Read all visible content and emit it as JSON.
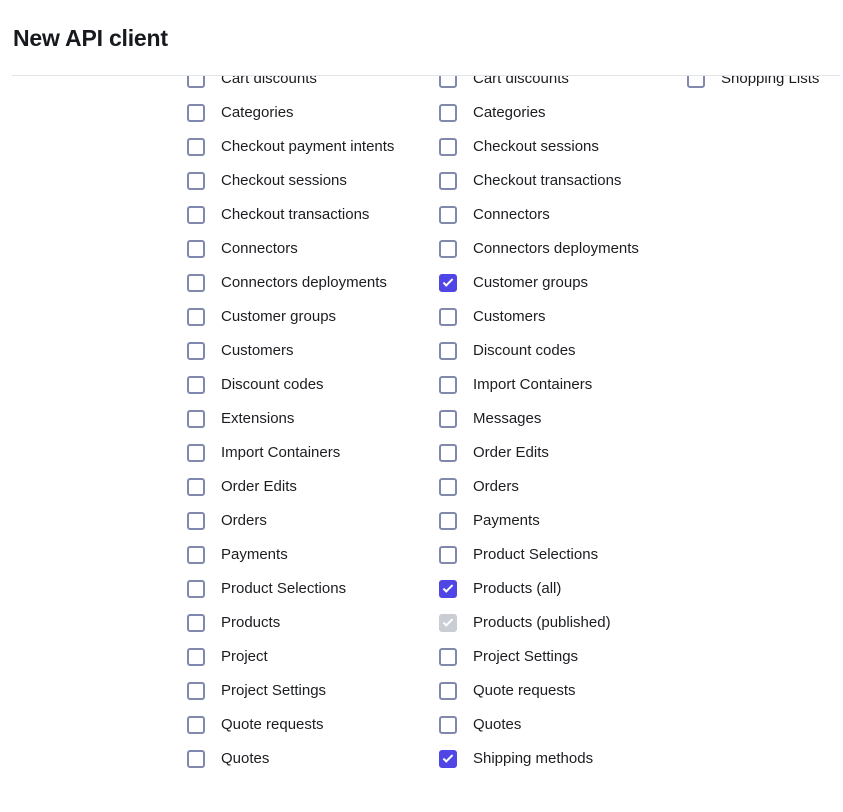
{
  "header": {
    "title": "New API client"
  },
  "scopes": {
    "columns": [
      {
        "name": "permissions-left",
        "items": [
          {
            "label": "Cart discounts",
            "checked": false,
            "disabled": false
          },
          {
            "label": "Categories",
            "checked": false,
            "disabled": false
          },
          {
            "label": "Checkout payment intents",
            "checked": false,
            "disabled": false
          },
          {
            "label": "Checkout sessions",
            "checked": false,
            "disabled": false
          },
          {
            "label": "Checkout transactions",
            "checked": false,
            "disabled": false
          },
          {
            "label": "Connectors",
            "checked": false,
            "disabled": false
          },
          {
            "label": "Connectors deployments",
            "checked": false,
            "disabled": false
          },
          {
            "label": "Customer groups",
            "checked": false,
            "disabled": false
          },
          {
            "label": "Customers",
            "checked": false,
            "disabled": false
          },
          {
            "label": "Discount codes",
            "checked": false,
            "disabled": false
          },
          {
            "label": "Extensions",
            "checked": false,
            "disabled": false
          },
          {
            "label": "Import Containers",
            "checked": false,
            "disabled": false
          },
          {
            "label": "Order Edits",
            "checked": false,
            "disabled": false
          },
          {
            "label": "Orders",
            "checked": false,
            "disabled": false
          },
          {
            "label": "Payments",
            "checked": false,
            "disabled": false
          },
          {
            "label": "Product Selections",
            "checked": false,
            "disabled": false
          },
          {
            "label": "Products",
            "checked": false,
            "disabled": false
          },
          {
            "label": "Project",
            "checked": false,
            "disabled": false
          },
          {
            "label": "Project Settings",
            "checked": false,
            "disabled": false
          },
          {
            "label": "Quote requests",
            "checked": false,
            "disabled": false
          },
          {
            "label": "Quotes",
            "checked": false,
            "disabled": false
          }
        ]
      },
      {
        "name": "permissions-mid",
        "items": [
          {
            "label": "Cart discounts",
            "checked": false,
            "disabled": false
          },
          {
            "label": "Categories",
            "checked": false,
            "disabled": false
          },
          {
            "label": "Checkout sessions",
            "checked": false,
            "disabled": false
          },
          {
            "label": "Checkout transactions",
            "checked": false,
            "disabled": false
          },
          {
            "label": "Connectors",
            "checked": false,
            "disabled": false
          },
          {
            "label": "Connectors deployments",
            "checked": false,
            "disabled": false
          },
          {
            "label": "Customer groups",
            "checked": true,
            "disabled": false
          },
          {
            "label": "Customers",
            "checked": false,
            "disabled": false
          },
          {
            "label": "Discount codes",
            "checked": false,
            "disabled": false
          },
          {
            "label": "Import Containers",
            "checked": false,
            "disabled": false
          },
          {
            "label": "Messages",
            "checked": false,
            "disabled": false
          },
          {
            "label": "Order Edits",
            "checked": false,
            "disabled": false
          },
          {
            "label": "Orders",
            "checked": false,
            "disabled": false
          },
          {
            "label": "Payments",
            "checked": false,
            "disabled": false
          },
          {
            "label": "Product Selections",
            "checked": false,
            "disabled": false
          },
          {
            "label": "Products (all)",
            "checked": true,
            "disabled": false
          },
          {
            "label": "Products (published)",
            "checked": true,
            "disabled": true
          },
          {
            "label": "Project Settings",
            "checked": false,
            "disabled": false
          },
          {
            "label": "Quote requests",
            "checked": false,
            "disabled": false
          },
          {
            "label": "Quotes",
            "checked": false,
            "disabled": false
          },
          {
            "label": "Shipping methods",
            "checked": true,
            "disabled": false
          }
        ]
      },
      {
        "name": "permissions-right",
        "items": [
          {
            "label": "Shopping Lists",
            "checked": false,
            "disabled": false
          }
        ]
      }
    ]
  },
  "colors": {
    "accent": "#5046e5",
    "checkbox_border": "#8089ad",
    "checkbox_disabled": "#c9cdd4",
    "text": "#1b1d21",
    "title": "#16191d",
    "divider": "#e3e4e8",
    "background": "#ffffff"
  }
}
